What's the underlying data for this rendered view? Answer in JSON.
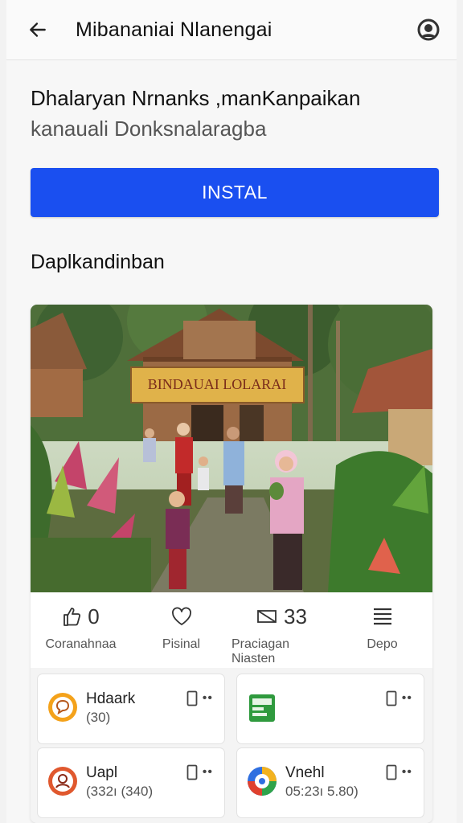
{
  "header": {
    "title": "Mibananiai Nlanengai",
    "back_icon": "arrow-left-icon",
    "profile_icon": "user-avatar-icon"
  },
  "intro": {
    "line1": "Dhalaryan Nrnanks ,manKanpaikan",
    "line2": "kanauali Donksnalaragba"
  },
  "install_label": "INSTAL",
  "section_title": "Daplkandinban",
  "photo": {
    "sign_text": "BINDAUAI LOLARAI"
  },
  "actions": [
    {
      "icon": "thumbs-up-icon",
      "count": "0",
      "label": "Coranahnaa"
    },
    {
      "icon": "heart-icon",
      "count": "",
      "label": "Pisinal"
    },
    {
      "icon": "flag-icon",
      "count": "33",
      "label": "Praciagan Niasten"
    },
    {
      "icon": "menu-icon",
      "count": "",
      "label": "Depo"
    }
  ],
  "tiles": [
    {
      "name": "Hdaark",
      "meta": "(30)",
      "icon": "chat-bubble-icon"
    },
    {
      "name": "",
      "meta": "",
      "icon": "green-app-icon"
    },
    {
      "name": "Uapl",
      "meta": "(332ı (340)",
      "icon": "profile-app-icon"
    },
    {
      "name": "Vnehl",
      "meta": "05:23ı 5.80)",
      "icon": "colorful-app-icon"
    }
  ],
  "colors": {
    "accent": "#1a4ff0"
  }
}
